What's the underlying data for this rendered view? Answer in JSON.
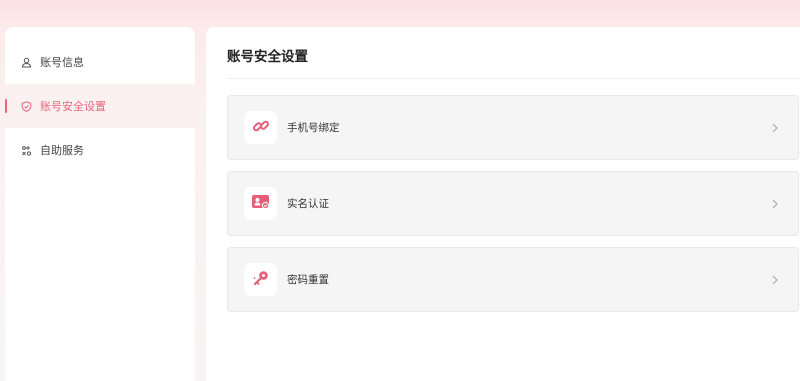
{
  "sidebar": {
    "items": [
      {
        "label": "账号信息",
        "icon": "user-icon",
        "active": false
      },
      {
        "label": "账号安全设置",
        "icon": "shield-icon",
        "active": true
      },
      {
        "label": "自助服务",
        "icon": "service-icon",
        "active": false
      }
    ]
  },
  "main": {
    "title": "账号安全设置",
    "cards": [
      {
        "label": "手机号绑定",
        "icon": "link-icon"
      },
      {
        "label": "实名认证",
        "icon": "id-card-icon"
      },
      {
        "label": "密码重置",
        "icon": "key-icon"
      }
    ]
  },
  "colors": {
    "accent": "#e8657a",
    "active_bg": "#fcf1f1",
    "card_bg": "#f5f5f5"
  }
}
